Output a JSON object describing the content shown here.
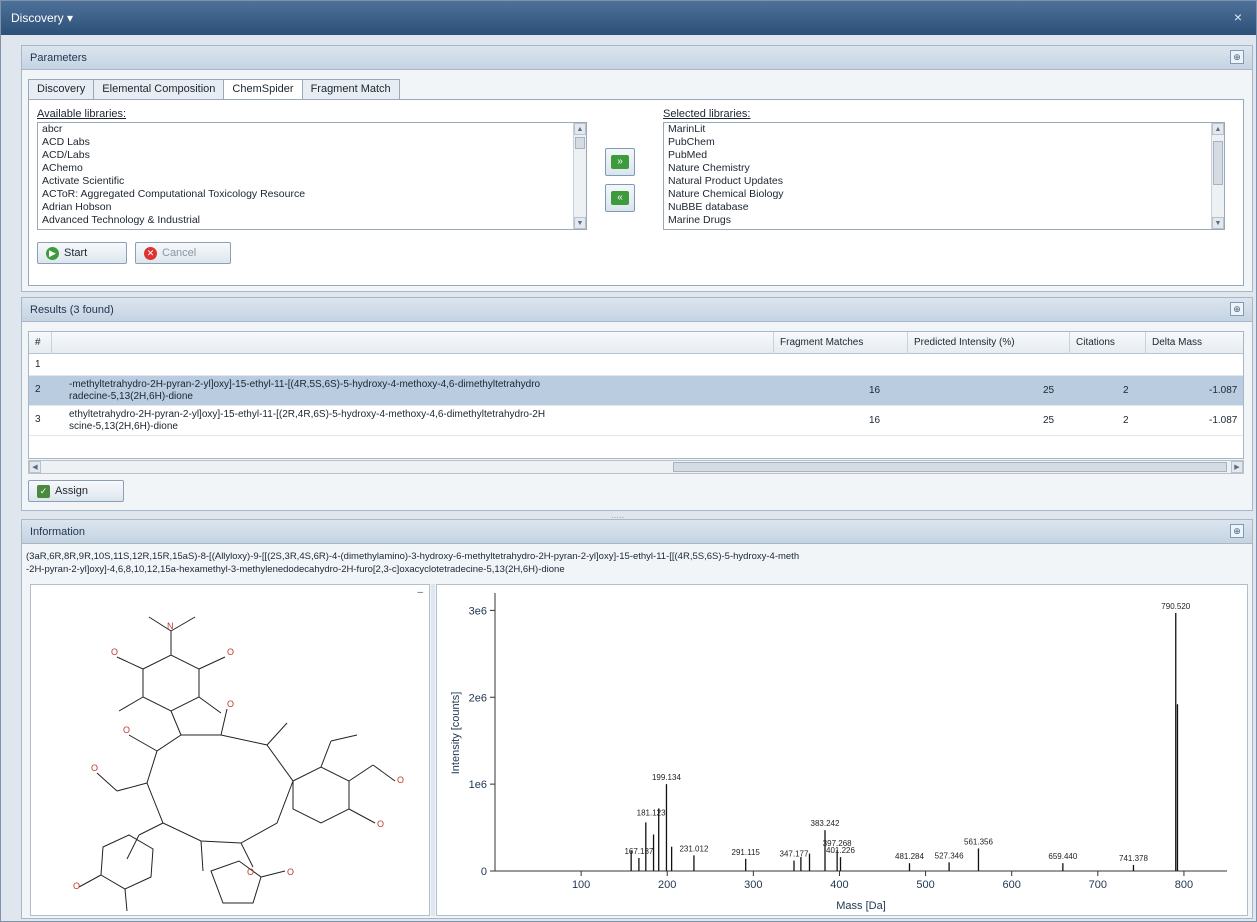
{
  "window": {
    "title": "Discovery",
    "title_arrow": "▾",
    "close_glyph": "×"
  },
  "parameters": {
    "title": "Parameters",
    "collapse_glyph": "⊕",
    "tabs": [
      {
        "label": "Discovery"
      },
      {
        "label": "Elemental Composition"
      },
      {
        "label": "ChemSpider"
      },
      {
        "label": "Fragment Match"
      }
    ],
    "available_label": "Available libraries:",
    "available_items": [
      "abcr",
      "ACD Labs",
      "ACD/Labs",
      "AChemo",
      "Activate Scientific",
      "ACToR: Aggregated Computational Toxicology Resource",
      "Adrian Hobson",
      "Advanced Technology & Industrial"
    ],
    "selected_label": "Selected libraries:",
    "selected_items": [
      "MarinLit",
      "PubChem",
      "PubMed",
      "Nature Chemistry",
      "Natural Product Updates",
      "Nature Chemical Biology",
      "NuBBE database",
      "Marine Drugs"
    ],
    "add_glyph": "»",
    "remove_glyph": "«",
    "start_label": "Start",
    "cancel_label": "Cancel"
  },
  "results": {
    "title": "Results (3 found)",
    "columns": {
      "index": "#",
      "name": "",
      "fragment_matches": "Fragment Matches",
      "predicted_intensity": "Predicted Intensity (%)",
      "citations": "Citations",
      "delta_mass": "Delta Mass"
    },
    "rows": [
      {
        "index": "1",
        "name_line1": "",
        "name_line2": "",
        "fragment_matches": "",
        "predicted_intensity": "",
        "citations": "",
        "delta_mass": ""
      },
      {
        "index": "2",
        "name_line1": "-methyltetrahydro-2H-pyran-2-yl]oxy]-15-ethyl-11-[(4R,5S,6S)-5-hydroxy-4-methoxy-4,6-dimethyltetrahydro",
        "name_line2": "radecine-5,13(2H,6H)-dione",
        "fragment_matches": "16",
        "predicted_intensity": "25",
        "citations": "2",
        "delta_mass": "-1.087"
      },
      {
        "index": "3",
        "name_line1": "ethyltetrahydro-2H-pyran-2-yl]oxy]-15-ethyl-11-[(2R,4R,6S)-5-hydroxy-4-methoxy-4,6-dimethyltetrahydro-2H",
        "name_line2": "scine-5,13(2H,6H)-dione",
        "fragment_matches": "16",
        "predicted_intensity": "25",
        "citations": "2",
        "delta_mass": "-1.087"
      }
    ],
    "assign_label": "Assign"
  },
  "information": {
    "title": "Information",
    "formula_line1": "(3aR,6R,8R,9R,10S,11S,12R,15R,15aS)-8-[(Allyloxy)-9-[[(2S,3R,4S,6R)-4-(dimethylamino)-3-hydroxy-6-methyltetrahydro-2H-pyran-2-yl]oxy]-15-ethyl-11-[[(4R,5S,6S)-5-hydroxy-4-meth",
    "formula_line2": "-2H-pyran-2-yl]oxy]-4,6,8,10,12,15a-hexamethyl-3-methylenedodecahydro-2H-furo[2,3-c]oxacyclotetradecine-5,13(2H,6H)-dione"
  },
  "chart_data": {
    "type": "bar",
    "xlabel": "Mass [Da]",
    "ylabel": "Intensity [counts]",
    "xlim": [
      0,
      850
    ],
    "ylim": [
      0,
      3200000
    ],
    "xticks": [
      100,
      200,
      300,
      400,
      500,
      600,
      700,
      800
    ],
    "yticks": [
      0,
      1000000,
      2000000,
      3000000
    ],
    "yticklabels": [
      "0",
      "1e6",
      "2e6",
      "3e6"
    ],
    "peaks": [
      {
        "x": 158.1,
        "y": 230000,
        "label": ""
      },
      {
        "x": 167.1,
        "y": 150000,
        "label": "167.137"
      },
      {
        "x": 175.1,
        "y": 560000,
        "label": ""
      },
      {
        "x": 184.1,
        "y": 420000,
        "label": ""
      },
      {
        "x": 190.1,
        "y": 720000,
        "label": ""
      },
      {
        "x": 199.1,
        "y": 1000000,
        "label": "199.134"
      },
      {
        "x": 205.1,
        "y": 280000,
        "label": ""
      },
      {
        "x": 231.0,
        "y": 180000,
        "label": "231.012"
      },
      {
        "x": 291.1,
        "y": 140000,
        "label": "291.115"
      },
      {
        "x": 347.2,
        "y": 120000,
        "label": "347.177"
      },
      {
        "x": 355.2,
        "y": 160000,
        "label": ""
      },
      {
        "x": 365.2,
        "y": 200000,
        "label": ""
      },
      {
        "x": 383.2,
        "y": 470000,
        "label": "383.242"
      },
      {
        "x": 397.3,
        "y": 240000,
        "label": "397.268"
      },
      {
        "x": 401.2,
        "y": 160000,
        "label": "401.226"
      },
      {
        "x": 481.3,
        "y": 90000,
        "label": "481.284"
      },
      {
        "x": 527.3,
        "y": 100000,
        "label": "527.346"
      },
      {
        "x": 561.4,
        "y": 260000,
        "label": "561.356"
      },
      {
        "x": 659.4,
        "y": 90000,
        "label": "659.440"
      },
      {
        "x": 741.4,
        "y": 70000,
        "label": "741.378"
      },
      {
        "x": 790.5,
        "y": 2970000,
        "label": "790.520"
      },
      {
        "x": 792.5,
        "y": 1920000,
        "label": ""
      }
    ],
    "extra_labels": [
      {
        "x": 181.3,
        "y": 640000,
        "label": "181.123"
      }
    ]
  }
}
